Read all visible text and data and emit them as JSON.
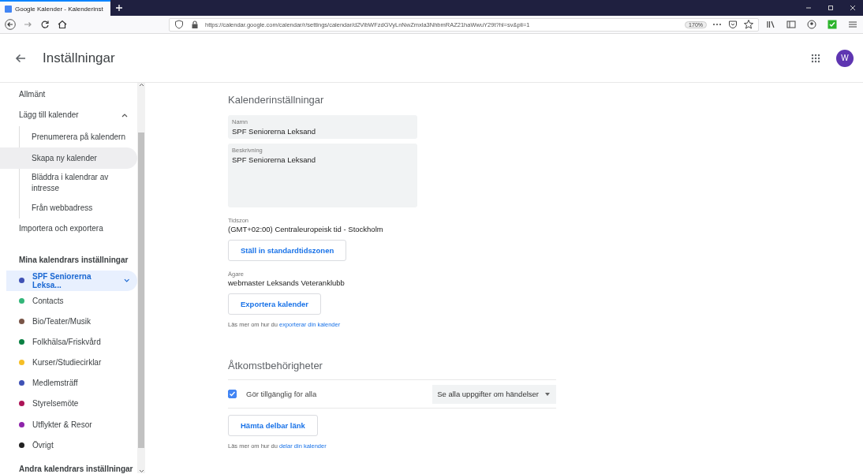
{
  "browser": {
    "tab": {
      "title": "Google Kalender - Kalenderinst",
      "selected": true
    },
    "url": "https://calendar.google.com/calendar/r/settings/calendar/d2VibWFzdGVyLnNwZmxla3NhbmRAZ21haWwuY29t?hl=sv&pli=1",
    "zoom": "170%"
  },
  "header": {
    "title": "Inställningar",
    "avatar": "W"
  },
  "sidebar": {
    "items": [
      {
        "kind": "section",
        "label": "Allmänt"
      },
      {
        "kind": "group",
        "label": "Lägg till kalender",
        "expanded": true,
        "children": [
          {
            "label": "Prenumerera på kalendern",
            "selected": false
          },
          {
            "label": "Skapa ny kalender",
            "selected": true
          },
          {
            "label": "Bläddra i kalendrar av intresse",
            "selected": false
          },
          {
            "label": "Från webbadress",
            "selected": false
          }
        ]
      },
      {
        "kind": "section",
        "label": "Importera och exportera"
      },
      {
        "kind": "heading",
        "label": "Mina kalendrars inställningar"
      },
      {
        "kind": "calendar",
        "label": "SPF Seniorerna Leksa...",
        "color": "#3f51b5",
        "selected": true
      },
      {
        "kind": "calendar",
        "label": "Contacts",
        "color": "#33b679",
        "selected": false
      },
      {
        "kind": "calendar",
        "label": "Bio/Teater/Musik",
        "color": "#795548",
        "selected": false
      },
      {
        "kind": "calendar",
        "label": "Folkhälsa/Friskvård",
        "color": "#0b8043",
        "selected": false
      },
      {
        "kind": "calendar",
        "label": "Kurser/Studiecirklar",
        "color": "#f6bf26",
        "selected": false
      },
      {
        "kind": "calendar",
        "label": "Medlemsträff",
        "color": "#3f51b5",
        "selected": false
      },
      {
        "kind": "calendar",
        "label": "Styrelsemöte",
        "color": "#ad1457",
        "selected": false
      },
      {
        "kind": "calendar",
        "label": "Utflykter & Resor",
        "color": "#8e24aa",
        "selected": false
      },
      {
        "kind": "calendar",
        "label": "Övrigt",
        "color": "#212121",
        "selected": false
      },
      {
        "kind": "heading",
        "label": "Andra kalendrars inställningar"
      }
    ]
  },
  "settings": {
    "title": "Kalenderinställningar",
    "name": {
      "label": "Namn",
      "value": "SPF Seniorerna Leksand"
    },
    "description": {
      "label": "Beskrivning",
      "value": "SPF Seniorerna Leksand"
    },
    "timezone": {
      "label": "Tidszon",
      "value": "(GMT+02:00) Centraleuropeisk tid - Stockholm",
      "button": "Ställ in standardtidszonen"
    },
    "owner": {
      "label": "Ägare",
      "value": "webmaster Leksands Veteranklubb"
    },
    "export_button": "Exportera kalender",
    "export_help": {
      "text": "Läs mer om hur du",
      "link": "exporterar din kalender"
    }
  },
  "access": {
    "title": "Åtkomstbehörigheter",
    "public": {
      "label": "Gör tillgänglig för alla",
      "checked": true,
      "option": "Se alla uppgifter om händelser"
    },
    "share_button": "Hämta delbar länk",
    "share_help": {
      "text": "Läs mer om hur du",
      "link": "delar din kalender"
    }
  }
}
